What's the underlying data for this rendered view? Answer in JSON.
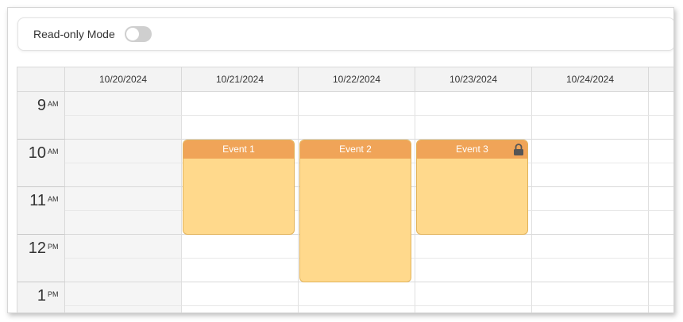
{
  "toolbar": {
    "readonly_label": "Read-only Mode",
    "readonly_enabled": false
  },
  "calendar": {
    "columns": [
      "10/20/2024",
      "10/21/2024",
      "10/22/2024",
      "10/23/2024",
      "10/24/2024",
      ""
    ],
    "hours": [
      {
        "num": "9",
        "suffix": "AM"
      },
      {
        "num": "10",
        "suffix": "AM"
      },
      {
        "num": "11",
        "suffix": "AM"
      },
      {
        "num": "12",
        "suffix": "PM"
      },
      {
        "num": "1",
        "suffix": "PM"
      }
    ],
    "events": [
      {
        "title": "Event 1",
        "day": "10/21/2024",
        "start": "10:00 AM",
        "end": "12:00 PM",
        "locked": false
      },
      {
        "title": "Event 2",
        "day": "10/22/2024",
        "start": "10:00 AM",
        "end": "1:00 PM",
        "locked": false
      },
      {
        "title": "Event 3",
        "day": "10/23/2024",
        "start": "10:00 AM",
        "end": "12:00 PM",
        "locked": true,
        "icon": "lock-icon"
      }
    ]
  },
  "colors": {
    "event_body": "#ffd98c",
    "event_header": "#f0a458",
    "header_bg": "#f3f3f3",
    "shaded_cell": "#f5f5f5"
  }
}
